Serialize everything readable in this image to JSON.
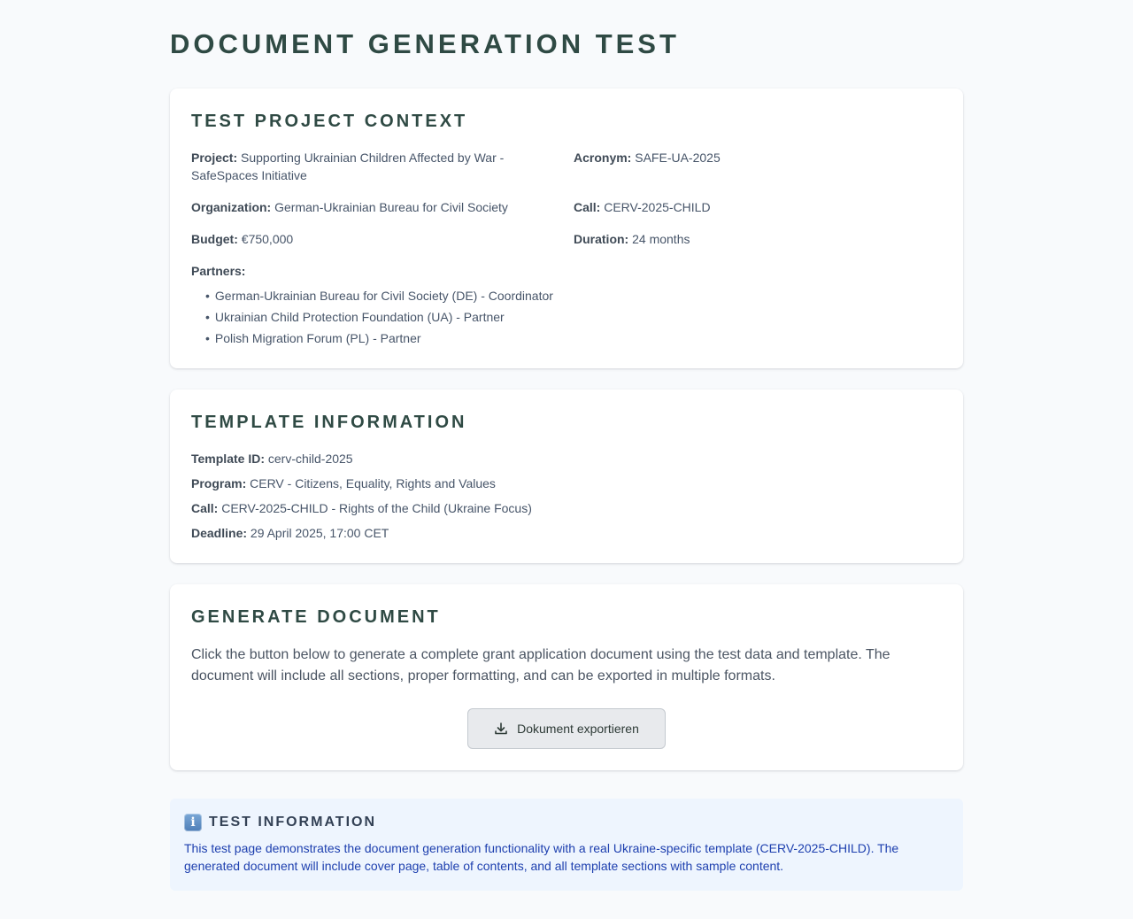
{
  "page": {
    "title": "DOCUMENT GENERATION TEST"
  },
  "context": {
    "heading": "TEST PROJECT CONTEXT",
    "project_label": "Project:",
    "project_value": "Supporting Ukrainian Children Affected by War - SafeSpaces Initiative",
    "acronym_label": "Acronym:",
    "acronym_value": "SAFE-UA-2025",
    "organization_label": "Organization:",
    "organization_value": "German-Ukrainian Bureau for Civil Society",
    "call_label": "Call:",
    "call_value": "CERV-2025-CHILD",
    "budget_label": "Budget:",
    "budget_value": "€750,000",
    "duration_label": "Duration:",
    "duration_value": "24 months",
    "partners_label": "Partners:",
    "partners": [
      "German-Ukrainian Bureau for Civil Society (DE) - Coordinator",
      "Ukrainian Child Protection Foundation (UA) - Partner",
      "Polish Migration Forum (PL) - Partner"
    ]
  },
  "template": {
    "heading": "TEMPLATE INFORMATION",
    "id_label": "Template ID:",
    "id_value": "cerv-child-2025",
    "program_label": "Program:",
    "program_value": "CERV - Citizens, Equality, Rights and Values",
    "call_label": "Call:",
    "call_value": "CERV-2025-CHILD - Rights of the Child (Ukraine Focus)",
    "deadline_label": "Deadline:",
    "deadline_value": "29 April 2025, 17:00 CET"
  },
  "generate": {
    "heading": "GENERATE DOCUMENT",
    "description": "Click the button below to generate a complete grant application document using the test data and template. The document will include all sections, proper formatting, and can be exported in multiple formats.",
    "button_label": "Dokument exportieren",
    "button_icon": "download-icon"
  },
  "info": {
    "icon": "info-icon",
    "icon_glyph": "i",
    "heading": "TEST INFORMATION",
    "text": "This test page demonstrates the document generation functionality with a real Ukraine-specific template (CERV-2025-CHILD). The generated document will include cover page, table of contents, and all template sections with sample content."
  }
}
